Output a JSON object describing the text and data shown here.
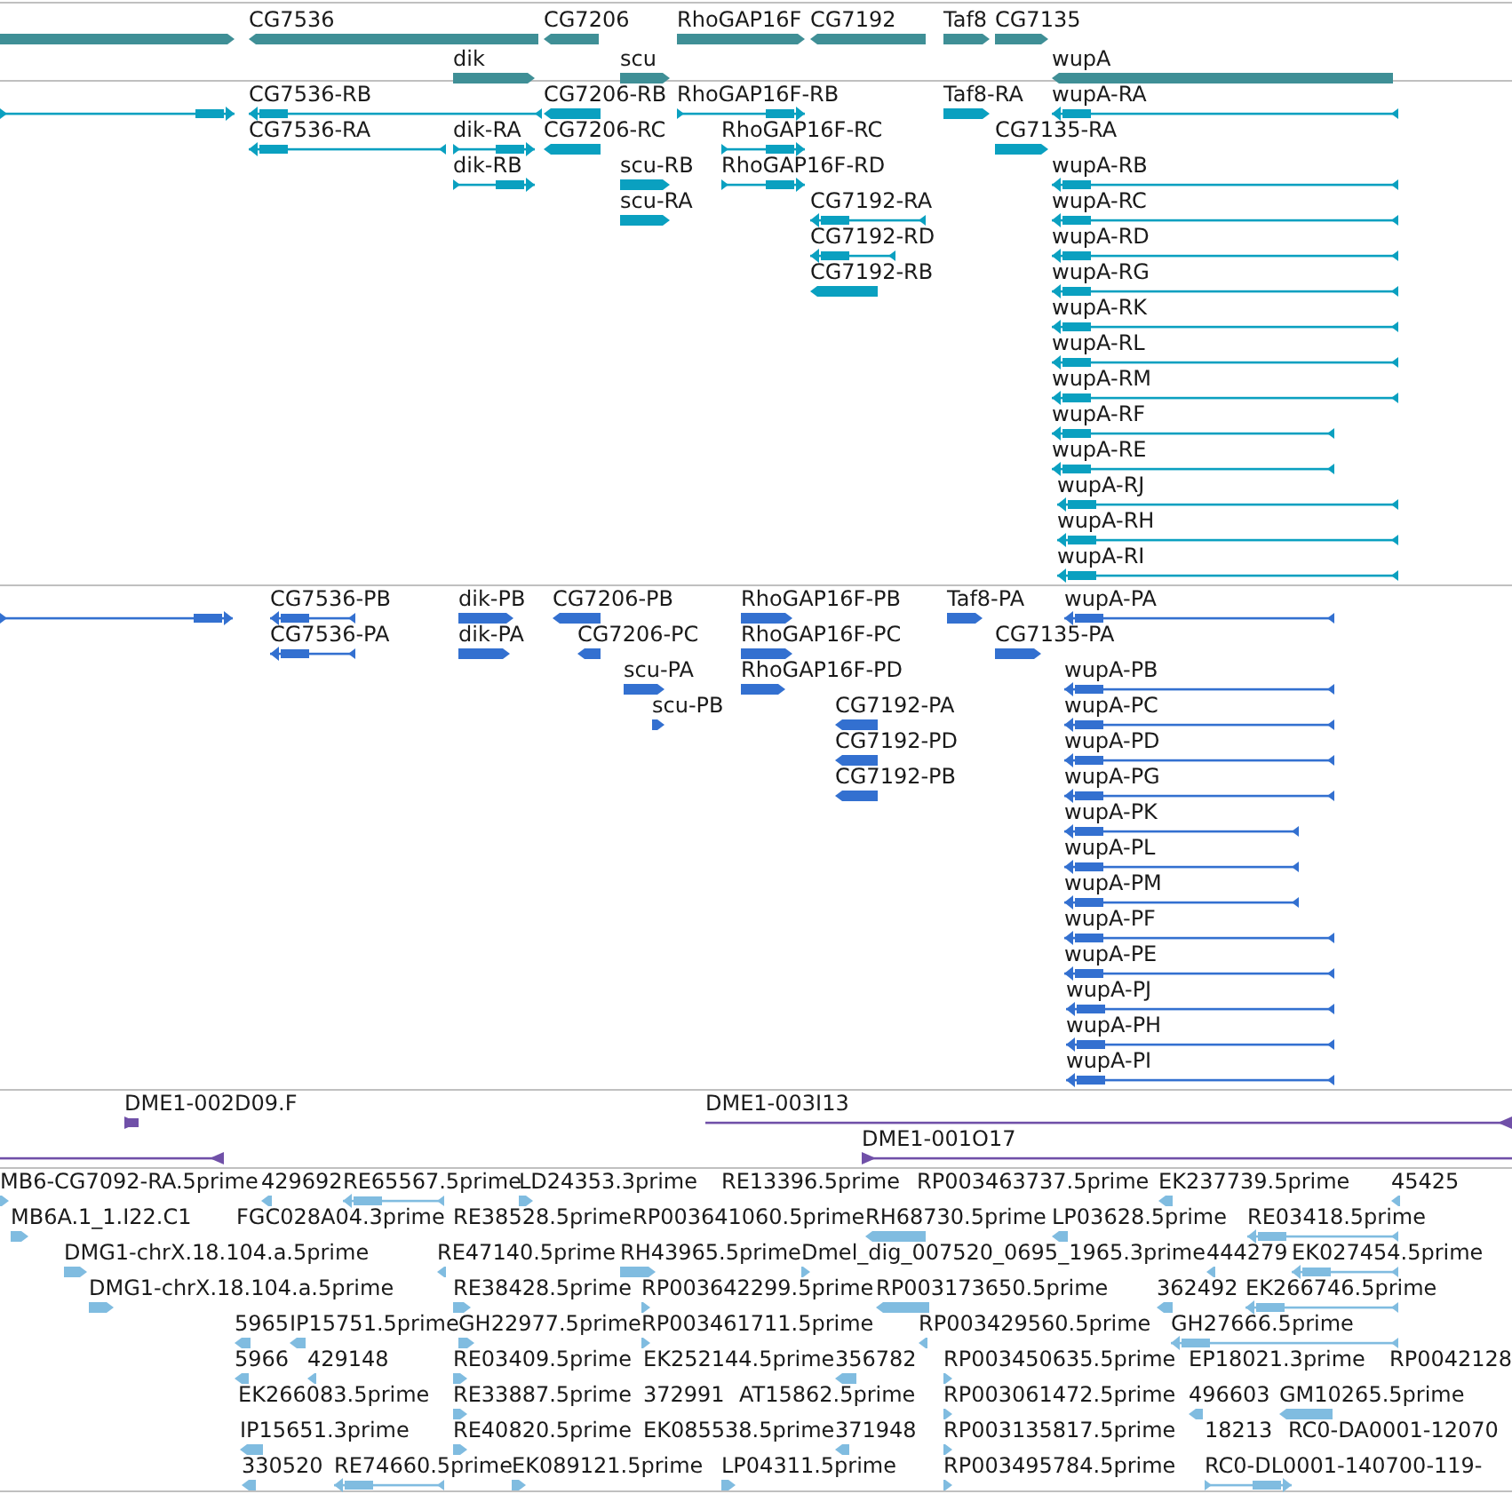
{
  "tracks": [
    {
      "color": "#3f8f96",
      "features": [
        {
          "reverse": false
        },
        {
          "label": "CG7536",
          "reverse": true
        },
        {
          "label": "CG7206",
          "reverse": true
        },
        {
          "label": "RhoGAP16F",
          "reverse": false
        },
        {
          "label": "CG7192",
          "reverse": true
        },
        {
          "label": "Taf8",
          "reverse": false
        },
        {
          "label": "CG7135",
          "reverse": false
        },
        {
          "label": "dik",
          "reverse": false
        },
        {
          "label": "scu",
          "reverse": false
        },
        {
          "label": "wupA",
          "reverse": true
        }
      ]
    },
    {
      "color": "#0aa0c0",
      "features": [
        {
          "reverse": false
        },
        {
          "label": "CG7536-RB",
          "reverse": true
        },
        {
          "label": "CG7206-RB",
          "reverse": true
        },
        {
          "label": "RhoGAP16F-RB",
          "reverse": false
        },
        {
          "label": "Taf8-RA",
          "reverse": false
        },
        {
          "label": "wupA-RA",
          "reverse": true
        },
        {
          "label": "CG7536-RA",
          "reverse": true
        },
        {
          "label": "dik-RA",
          "reverse": false
        },
        {
          "label": "CG7206-RC",
          "reverse": true
        },
        {
          "label": "RhoGAP16F-RC",
          "reverse": false
        },
        {
          "label": "CG7135-RA",
          "reverse": false
        },
        {
          "label": "dik-RB",
          "reverse": false
        },
        {
          "label": "scu-RB",
          "reverse": false
        },
        {
          "label": "RhoGAP16F-RD",
          "reverse": false
        },
        {
          "label": "wupA-RB",
          "reverse": true
        },
        {
          "label": "scu-RA",
          "reverse": false
        },
        {
          "label": "CG7192-RA",
          "reverse": true
        },
        {
          "label": "wupA-RC",
          "reverse": true
        },
        {
          "label": "CG7192-RD",
          "reverse": true
        },
        {
          "label": "wupA-RD",
          "reverse": true
        },
        {
          "label": "CG7192-RB",
          "reverse": true
        },
        {
          "label": "wupA-RG",
          "reverse": true
        },
        {
          "label": "wupA-RK",
          "reverse": true
        },
        {
          "label": "wupA-RL",
          "reverse": true
        },
        {
          "label": "wupA-RM",
          "reverse": true
        },
        {
          "label": "wupA-RF",
          "reverse": true
        },
        {
          "label": "wupA-RE",
          "reverse": true
        },
        {
          "label": "wupA-RJ",
          "reverse": true
        },
        {
          "label": "wupA-RH",
          "reverse": true
        },
        {
          "label": "wupA-RI",
          "reverse": true
        }
      ]
    },
    {
      "color": "#3370d0",
      "features": [
        {
          "reverse": false
        },
        {
          "label": "CG7536-PB",
          "reverse": true
        },
        {
          "label": "dik-PB",
          "reverse": false
        },
        {
          "label": "CG7206-PB",
          "reverse": true
        },
        {
          "label": "RhoGAP16F-PB",
          "reverse": false
        },
        {
          "label": "Taf8-PA",
          "reverse": false
        },
        {
          "label": "wupA-PA",
          "reverse": true
        },
        {
          "label": "CG7536-PA",
          "reverse": true
        },
        {
          "label": "dik-PA",
          "reverse": false
        },
        {
          "label": "CG7206-PC",
          "reverse": true
        },
        {
          "label": "RhoGAP16F-PC",
          "reverse": false
        },
        {
          "label": "CG7135-PA",
          "reverse": false
        },
        {
          "label": "scu-PA",
          "reverse": false
        },
        {
          "label": "RhoGAP16F-PD",
          "reverse": false
        },
        {
          "label": "wupA-PB",
          "reverse": true
        },
        {
          "label": "scu-PB",
          "reverse": false
        },
        {
          "label": "CG7192-PA",
          "reverse": true
        },
        {
          "label": "wupA-PC",
          "reverse": true
        },
        {
          "label": "CG7192-PD",
          "reverse": true
        },
        {
          "label": "wupA-PD",
          "reverse": true
        },
        {
          "label": "CG7192-PB",
          "reverse": true
        },
        {
          "label": "wupA-PG",
          "reverse": true
        },
        {
          "label": "wupA-PK",
          "reverse": true
        },
        {
          "label": "wupA-PL",
          "reverse": true
        },
        {
          "label": "wupA-PM",
          "reverse": true
        },
        {
          "label": "wupA-PF",
          "reverse": true
        },
        {
          "label": "wupA-PE",
          "reverse": true
        },
        {
          "label": "wupA-PJ",
          "reverse": true
        },
        {
          "label": "wupA-PH",
          "reverse": true
        },
        {
          "label": "wupA-PI",
          "reverse": true
        }
      ]
    },
    {
      "color": "#7050a8",
      "features": [
        {
          "label": "DME1-002D09.F",
          "reverse": false
        },
        {
          "label": "DME1-003I13",
          "reverse": true
        },
        {
          "reverse": true
        },
        {
          "label": "DME1-001O17",
          "reverse": false
        }
      ]
    },
    {
      "color": "#80bce0",
      "features": [
        {
          "label": "MB6-CG7092-RA.5prime",
          "reverse": false
        },
        {
          "label": "429692",
          "reverse": true
        },
        {
          "label": "RE65567.5prime",
          "reverse": true
        },
        {
          "label": "LD24353.3prime",
          "reverse": false
        },
        {
          "label": "RE13396.5prime"
        },
        {
          "label": "RP003463737.5prime"
        },
        {
          "label": "EK237739.5prime",
          "reverse": true
        },
        {
          "label": "45425",
          "reverse": true
        },
        {
          "label": "MB6A.1_1.I22.C1",
          "reverse": false
        },
        {
          "label": "FGC028A04.3prime"
        },
        {
          "label": "RE38528.5prime"
        },
        {
          "label": "RP003641060.5prime"
        },
        {
          "label": "RH68730.5prime",
          "reverse": true
        },
        {
          "label": "LP03628.5prime",
          "reverse": true
        },
        {
          "label": "RE03418.5prime",
          "reverse": true
        },
        {
          "label": "DMG1-chrX.18.104.a.5prime",
          "reverse": false
        },
        {
          "label": "RE47140.5prime",
          "reverse": true
        },
        {
          "label": "RH43965.5prime",
          "reverse": false
        },
        {
          "label": "Dmel_dig_007520_0695_1965.3prime",
          "reverse": false
        },
        {
          "label": "444279",
          "reverse": true
        },
        {
          "label": "EK027454.5prime",
          "reverse": true
        },
        {
          "label": "DMG1-chrX.18.104.a.5prime",
          "reverse": false
        },
        {
          "label": "RE38428.5prime",
          "reverse": false
        },
        {
          "label": "RP003642299.5prime",
          "reverse": false
        },
        {
          "label": "RP003173650.5prime",
          "reverse": true
        },
        {
          "label": "362492",
          "reverse": true
        },
        {
          "label": "EK266746.5prime",
          "reverse": true
        },
        {
          "label": "5965",
          "reverse": true
        },
        {
          "label": "IP15751.5prime",
          "reverse": true
        },
        {
          "label": "GH22977.5prime",
          "reverse": false
        },
        {
          "label": "RP003461711.5prime",
          "reverse": false
        },
        {
          "label": "RP003429560.5prime",
          "reverse": true
        },
        {
          "label": "GH27666.5prime",
          "reverse": true
        },
        {
          "label": "5966",
          "reverse": true
        },
        {
          "label": "429148",
          "reverse": true
        },
        {
          "label": "RE03409.5prime",
          "reverse": false
        },
        {
          "label": "EK252144.5prime"
        },
        {
          "label": "356782",
          "reverse": true
        },
        {
          "label": "RP003450635.5prime",
          "reverse": false
        },
        {
          "label": "EP18021.3prime"
        },
        {
          "label": "RP0042128"
        },
        {
          "label": "EK266083.5prime"
        },
        {
          "label": "RE33887.5prime",
          "reverse": false
        },
        {
          "label": "372991"
        },
        {
          "label": "AT15862.5prime"
        },
        {
          "label": "RP003061472.5prime",
          "reverse": false
        },
        {
          "label": "496603",
          "reverse": true
        },
        {
          "label": "GM10265.5prime",
          "reverse": true
        },
        {
          "label": "IP15651.3prime",
          "reverse": true
        },
        {
          "label": "RE40820.5prime",
          "reverse": false
        },
        {
          "label": "EK085538.5prime"
        },
        {
          "label": "371948",
          "reverse": true
        },
        {
          "label": "RP003135817.5prime",
          "reverse": false
        },
        {
          "label": "18213"
        },
        {
          "label": "RC0-DA0001-12070"
        },
        {
          "label": "330520",
          "reverse": true
        },
        {
          "label": "RE74660.5prime",
          "reverse": true
        },
        {
          "label": "EK089121.5prime",
          "reverse": false
        },
        {
          "label": "LP04311.5prime",
          "reverse": false
        },
        {
          "label": "RP003495784.5prime",
          "reverse": false
        },
        {
          "label": "RC0-DL0001-140700-119-",
          "reverse": false
        }
      ]
    }
  ]
}
